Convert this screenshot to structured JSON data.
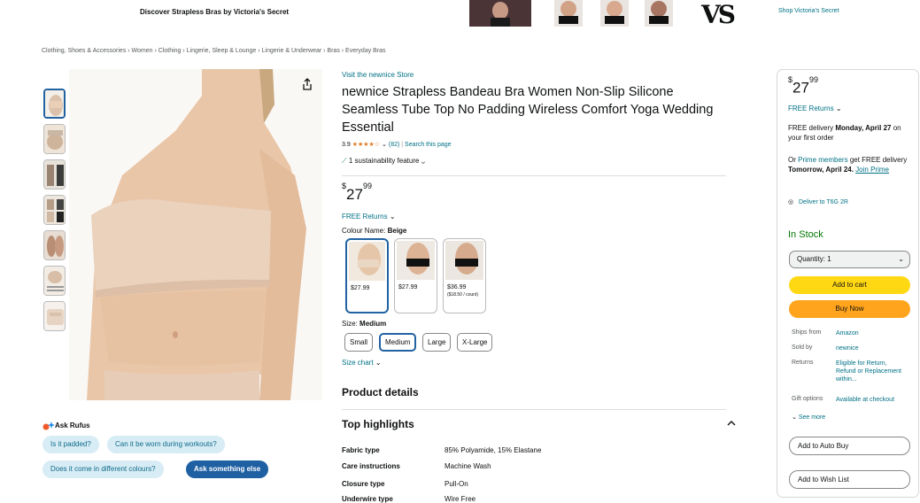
{
  "banner": {
    "title": "Discover Strapless Bras by Victoria's Secret",
    "shop_link": "Shop Victoria's Secret",
    "logo_text": "VS"
  },
  "breadcrumb": "Clothing, Shoes & Accessories › Women › Clothing › Lingerie, Sleep & Lounge › Lingerie & Underwear › Bras › Everyday Bras",
  "rufus": {
    "title": "Ask Rufus",
    "q1": "Is it padded?",
    "q2": "Can it be worn during workouts?",
    "q3": "Does it come in different colours?",
    "ask": "Ask something else"
  },
  "product": {
    "store_link": "Visit the newnice Store",
    "title": "newnice Strapless Bandeau Bra Women Non-Slip Silicone Seamless Tube Top No Padding Wireless Comfort Yoga Wedding Essential",
    "rating": "3.9",
    "stars": "★★★★☆",
    "rating_count": "(82)",
    "search_page": "Search this page",
    "sustainability": "1 sustainability feature",
    "price_symbol": "$",
    "price_whole": "27",
    "price_fraction": "99",
    "free_returns": "FREE Returns",
    "colour_label": "Colour Name:",
    "colour_value": "Beige",
    "swatches": [
      {
        "price": "$27.99",
        "sub": ""
      },
      {
        "price": "$27.99",
        "sub": ""
      },
      {
        "price": "$36.99",
        "sub": "($18.50 / count)"
      }
    ],
    "size_label": "Size:",
    "size_value": "Medium",
    "sizes": [
      "Small",
      "Medium",
      "Large",
      "X-Large"
    ],
    "size_chart": "Size chart",
    "product_details": "Product details",
    "top_highlights": "Top highlights",
    "specs": [
      {
        "k": "Fabric type",
        "v": "85% Polyamide, 15% Elastane"
      },
      {
        "k": "Care instructions",
        "v": "Machine Wash"
      },
      {
        "k": "Closure type",
        "v": "Pull-On"
      },
      {
        "k": "Underwire type",
        "v": "Wire Free"
      }
    ]
  },
  "buybox": {
    "price_symbol": "$",
    "price_whole": "27",
    "price_fraction": "99",
    "free_returns": "FREE Returns",
    "delivery_pre": "FREE delivery",
    "delivery_date": "Monday, April 27",
    "delivery_post": "on your first order",
    "prime_pre": "Or",
    "prime_link": "Prime members",
    "prime_mid": "get FREE delivery",
    "prime_date": "Tomorrow, April 24.",
    "join_prime": "Join Prime",
    "deliver_to": "Deliver to  T6G 2R",
    "stock": "In Stock",
    "quantity": "Quantity: 1",
    "add_to_cart": "Add to cart",
    "buy_now": "Buy Now",
    "ships_from_k": "Ships from",
    "ships_from_v": "Amazon",
    "sold_by_k": "Sold by",
    "sold_by_v": "newnice",
    "returns_k": "Returns",
    "returns_v": "Eligible for Return, Refund or Replacement within...",
    "gift_k": "Gift options",
    "gift_v": "Available at checkout",
    "see_more": "See more",
    "auto_buy": "Add to Auto Buy",
    "wish_list": "Add to Wish List"
  },
  "colors": {
    "link": "#007185",
    "yellow": "#ffd814",
    "orange": "#ffa41c",
    "stock": "#007600",
    "selected": "#2162a1"
  }
}
